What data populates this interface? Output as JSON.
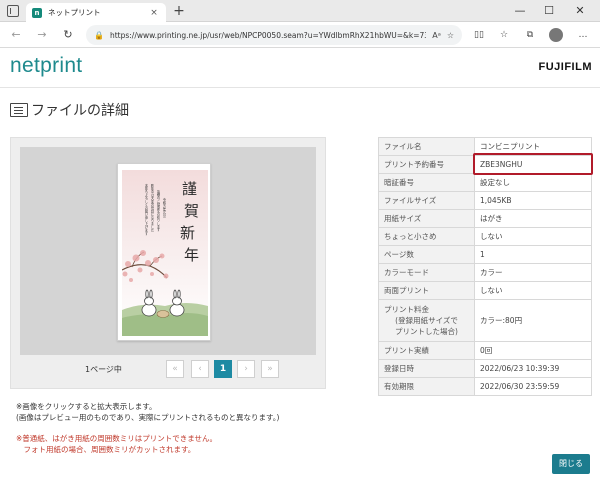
{
  "browser": {
    "tab_title": "ネットプリント",
    "tab_close": "×",
    "new_tab": "+",
    "url": "https://www.printing.ne.jp/usr/web/NPCP0050.seam?u=YWdlbmRhX21hbWU=&k=73833...",
    "read_aloud": "A̅",
    "win_min": "—",
    "win_max": "☐",
    "win_close": "✕",
    "back": "←",
    "forward": "→",
    "refresh": "↻",
    "more": "…"
  },
  "header": {
    "logo": "netprint",
    "brand": "FUJIFILM"
  },
  "page_title": "ファイルの詳細",
  "preview": {
    "page_count": "1ページ中",
    "pager": {
      "first": "«",
      "prev": "‹",
      "current": "1",
      "next": "›",
      "last": "»"
    },
    "postcard": {
      "big_text": [
        "謹",
        "賀",
        "新",
        "年"
      ],
      "small_text": "本年もよろしくお願い申し上げます"
    }
  },
  "notes": {
    "line1": "※画像をクリックすると拡大表示します。",
    "line2": "(画像はプレビュー用のものであり、実際にプリントされるものと異なります。)",
    "red1": "※普通紙、はがき用紙の周囲数ミリはプリントできません。",
    "red2": "　フォト用紙の場合、周囲数ミリがカットされます。"
  },
  "details": [
    {
      "label": "ファイル名",
      "value": "コンビニプリント"
    },
    {
      "label": "プリント予約番号",
      "value": "ZBE3NGHU"
    },
    {
      "label": "暗証番号",
      "value": "設定なし"
    },
    {
      "label": "ファイルサイズ",
      "value": "1,045KB"
    },
    {
      "label": "用紙サイズ",
      "value": "はがき"
    },
    {
      "label": "ちょっと小さめ",
      "value": "しない"
    },
    {
      "label": "ページ数",
      "value": "1"
    },
    {
      "label": "カラーモード",
      "value": "カラー"
    },
    {
      "label": "両面プリント",
      "value": "しない"
    },
    {
      "label": "プリント料金",
      "label_sub1": "(登録用紙サイズで",
      "label_sub2": "プリントした場合)",
      "value": "カラー:80円"
    },
    {
      "label": "プリント実績",
      "value": "0回"
    },
    {
      "label": "登録日時",
      "value": "2022/06/23 10:39:39"
    },
    {
      "label": "有効期限",
      "value": "2022/06/30 23:59:59"
    }
  ],
  "close_button": "閉じる",
  "colors": {
    "brand_teal": "#1e8a8d",
    "highlight_red": "#b11b2a",
    "pager_active": "#1d8aa3",
    "close_button": "#1c7c8e"
  }
}
